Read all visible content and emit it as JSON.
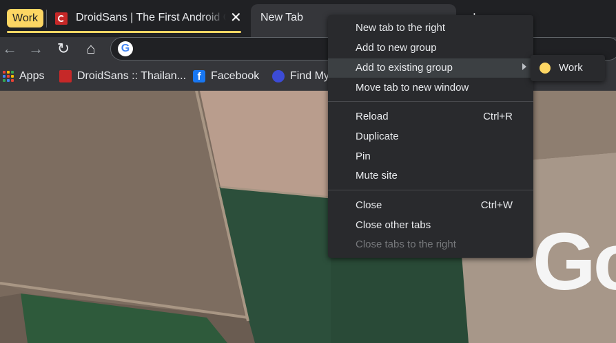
{
  "tab_group": {
    "label": "Work",
    "color": "#fdd663"
  },
  "tabs": [
    {
      "title": "DroidSans | The First Android Community in Thailand"
    },
    {
      "title": "New Tab"
    }
  ],
  "bookmarks": [
    {
      "label": "Apps",
      "icon": "apps-grid-icon"
    },
    {
      "label": "DroidSans :: Thailan...",
      "icon": "droidsans-favicon"
    },
    {
      "label": "Facebook",
      "icon": "facebook-icon"
    },
    {
      "label": "Find My",
      "icon": "find-my-icon"
    }
  ],
  "context_menu": {
    "items": [
      {
        "label": "New tab to the right"
      },
      {
        "label": "Add to new group"
      },
      {
        "label": "Add to existing group",
        "submenu": true,
        "highlighted": true
      },
      {
        "label": "Move tab to new window"
      },
      {
        "label": "Reload",
        "shortcut": "Ctrl+R"
      },
      {
        "label": "Duplicate"
      },
      {
        "label": "Pin"
      },
      {
        "label": "Mute site"
      },
      {
        "label": "Close",
        "shortcut": "Ctrl+W"
      },
      {
        "label": "Close other tabs"
      },
      {
        "label": "Close tabs to the right",
        "disabled": true
      }
    ]
  },
  "submenu": {
    "items": [
      {
        "label": "Work",
        "color": "#fdd663"
      }
    ]
  },
  "page": {
    "logo_partial": "Go"
  }
}
